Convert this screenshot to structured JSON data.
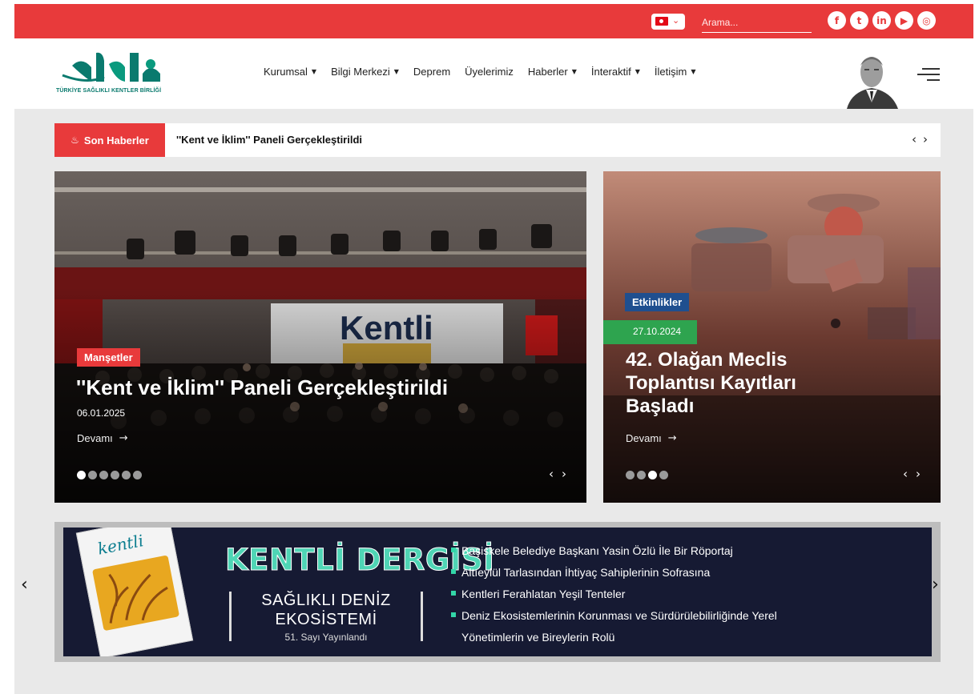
{
  "topbar": {
    "search_placeholder": "Arama...",
    "socials": [
      {
        "name": "facebook-icon",
        "glyph": "f"
      },
      {
        "name": "twitter-icon",
        "glyph": "t"
      },
      {
        "name": "linkedin-icon",
        "glyph": "in"
      },
      {
        "name": "youtube-icon",
        "glyph": "▶"
      },
      {
        "name": "instagram-icon",
        "glyph": "◎"
      }
    ],
    "color": "#e83a3b"
  },
  "header": {
    "logo_caption": "TÜRKİYE SAĞLIKLI KENTLER BİRLİĞİ",
    "nav": [
      {
        "label": "Kurumsal",
        "dropdown": true
      },
      {
        "label": "Bilgi Merkezi",
        "dropdown": true
      },
      {
        "label": "Deprem",
        "dropdown": false
      },
      {
        "label": "Üyelerimiz",
        "dropdown": false
      },
      {
        "label": "Haberler",
        "dropdown": true
      },
      {
        "label": "İnteraktif",
        "dropdown": true
      },
      {
        "label": "İletişim",
        "dropdown": true
      }
    ]
  },
  "ticker": {
    "label": "Son Haberler",
    "headline": "''Kent ve İklim'' Paneli Gerçekleştirildi"
  },
  "main_slider": {
    "category": "Manşetler",
    "title": "''Kent ve İklim'' Paneli Gerçekleştirildi",
    "date": "06.01.2025",
    "more": "Devamı",
    "dots": 6,
    "active_dot": 0,
    "screen_text": "Kentli"
  },
  "side_slider": {
    "category": "Etkinlikler",
    "date": "27.10.2024",
    "title_lines": [
      "42. Olağan Meclis",
      "Toplantısı Kayıtları",
      "Başladı"
    ],
    "more": "Devamı",
    "dots": 4,
    "active_dot": 2
  },
  "banner": {
    "magazine_title": "kentli",
    "heading": "KENTLİ DERGİSİ",
    "issue_line1": "SAĞLIKLI DENİZ",
    "issue_line2": "EKOSİSTEMİ",
    "issue_line3": "51. Sayı Yayınlandı",
    "bullets": [
      "Başiskele Belediye Başkanı Yasin Özlü İle Bir Röportaj",
      "Altıeylül Tarlasından İhtiyaç Sahiplerinin Sofrasına",
      "Kentleri Ferahlatan Yeşil Tenteler",
      "Deniz Ekosistemlerinin Korunması ve Sürdürülebilirliğinde Yerel",
      "Yönetimlerin ve Bireylerin Rolü"
    ]
  }
}
